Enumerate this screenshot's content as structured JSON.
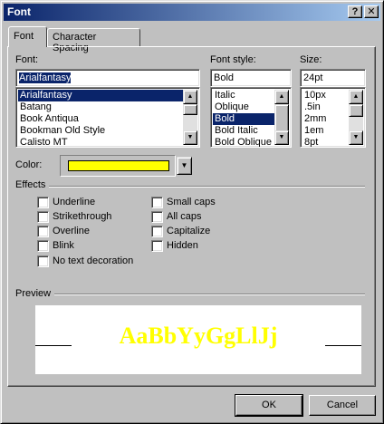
{
  "window": {
    "title": "Font",
    "help_glyph": "?",
    "close_glyph": "✕"
  },
  "tabs": [
    {
      "label": "Font"
    },
    {
      "label": "Character Spacing"
    }
  ],
  "font": {
    "label": "Font:",
    "value": "Arialfantasy",
    "items": [
      "Arialfantasy",
      "Batang",
      "Book Antiqua",
      "Bookman Old Style",
      "Calisto MT"
    ],
    "selected_index": 0
  },
  "font_style": {
    "label": "Font style:",
    "value": "Bold",
    "items": [
      "Italic",
      "Oblique",
      "Bold",
      "Bold Italic",
      "Bold Oblique"
    ],
    "selected_index": 2
  },
  "size": {
    "label": "Size:",
    "value": "24pt",
    "items": [
      "10px",
      ".5in",
      "2mm",
      "1em",
      "8pt"
    ]
  },
  "color": {
    "label": "Color:",
    "value": "#ffff00"
  },
  "effects": {
    "title": "Effects",
    "left": [
      {
        "label": "Underline",
        "checked": false
      },
      {
        "label": "Strikethrough",
        "checked": false
      },
      {
        "label": "Overline",
        "checked": false
      },
      {
        "label": "Blink",
        "checked": false
      },
      {
        "label": "No text decoration",
        "checked": false
      }
    ],
    "right": [
      {
        "label": "Small caps",
        "checked": false
      },
      {
        "label": "All caps",
        "checked": false
      },
      {
        "label": "Capitalize",
        "checked": false
      },
      {
        "label": "Hidden",
        "checked": false
      }
    ]
  },
  "preview": {
    "title": "Preview",
    "sample": "AaBbYyGgLlJj"
  },
  "buttons": {
    "ok": "OK",
    "cancel": "Cancel"
  },
  "colors": {
    "title_start": "#0a246a",
    "title_end": "#a6caf0",
    "face": "#c0c0c0",
    "selection": "#0a246a",
    "preview_text": "#ffff00"
  }
}
